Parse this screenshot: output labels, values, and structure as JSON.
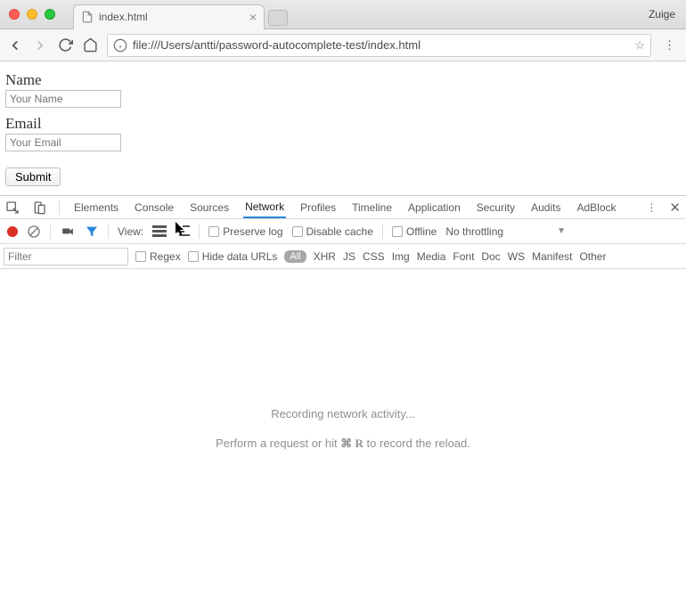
{
  "window": {
    "profile": "Zuige",
    "tab_title": "index.html",
    "url": "file:///Users/antti/password-autocomplete-test/index.html"
  },
  "page": {
    "name_label": "Name",
    "name_placeholder": "Your Name",
    "email_label": "Email",
    "email_placeholder": "Your Email",
    "submit_label": "Submit"
  },
  "devtools": {
    "tabs": [
      "Elements",
      "Console",
      "Sources",
      "Network",
      "Profiles",
      "Timeline",
      "Application",
      "Security",
      "Audits",
      "AdBlock"
    ],
    "active_tab": "Network",
    "row2": {
      "view_label": "View:",
      "preserve_log": "Preserve log",
      "disable_cache": "Disable cache",
      "offline": "Offline",
      "throttling": "No throttling"
    },
    "row3": {
      "filter_placeholder": "Filter",
      "regex": "Regex",
      "hide_data_urls": "Hide data URLs",
      "types": [
        "All",
        "XHR",
        "JS",
        "CSS",
        "Img",
        "Media",
        "Font",
        "Doc",
        "WS",
        "Manifest",
        "Other"
      ]
    },
    "body": {
      "line1": "Recording network activity...",
      "line2_pre": "Perform a request or hit ",
      "line2_key": "⌘ R",
      "line2_post": " to record the reload."
    }
  }
}
